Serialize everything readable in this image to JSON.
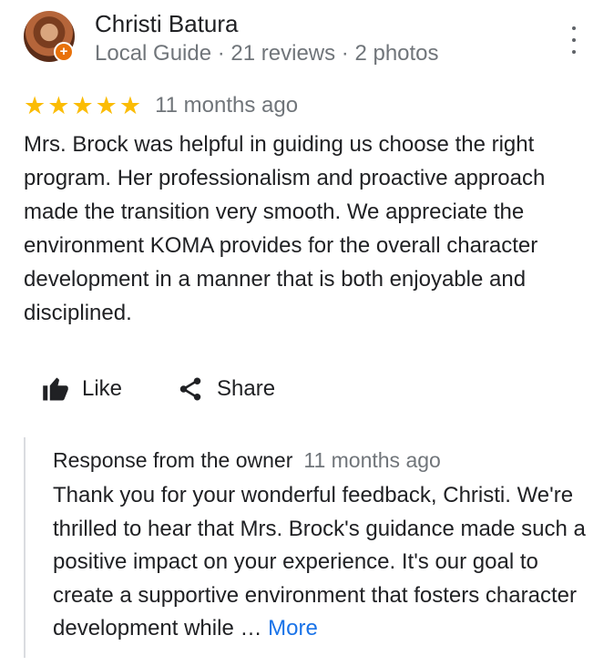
{
  "reviewer": {
    "name": "Christi Batura",
    "meta": "Local Guide · 21 reviews · 2 photos"
  },
  "review": {
    "stars": [
      "★",
      "★",
      "★",
      "★",
      "★"
    ],
    "date": "11 months ago",
    "text": "Mrs. Brock was helpful in guiding us choose the right program. Her professionalism and proactive approach made the transition very smooth. We appreciate the environment KOMA provides for the overall character development in a manner that is both enjoyable and disciplined."
  },
  "actions": {
    "like_label": "Like",
    "share_label": "Share"
  },
  "owner_response": {
    "title": "Response from the owner",
    "date": "11 months ago",
    "text": "Thank you for your wonderful feedback, Christi. We're thrilled to hear that Mrs. Brock's guidance made such a positive impact on your experience. It's our goal to create a supportive environment that fosters character development while … ",
    "more_label": "More"
  },
  "colors": {
    "star": "#fbbc04",
    "secondary_text": "#70757a",
    "link": "#1a73e8",
    "local_guide_badge": "#e8710a"
  },
  "icons": {
    "like": "thumbs-up-icon",
    "share": "share-icon",
    "more": "more-vert-icon",
    "badge": "local-guide-badge-icon"
  }
}
